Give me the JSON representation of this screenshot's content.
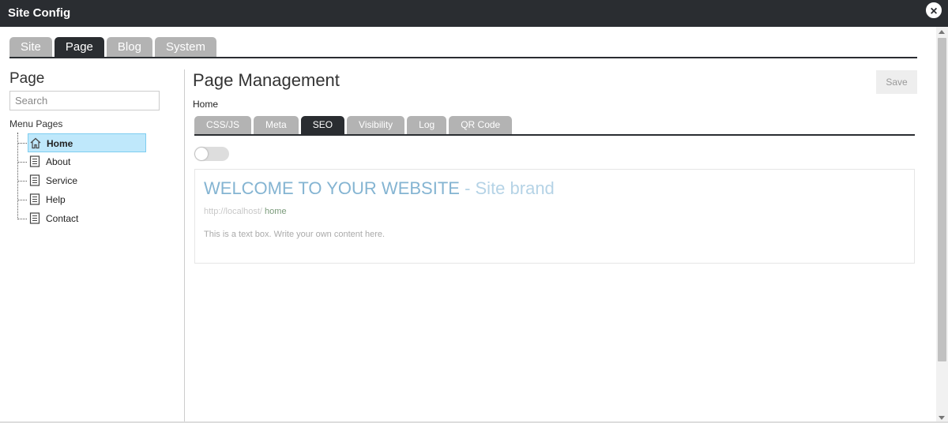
{
  "window": {
    "title": "Site Config",
    "close_icon": "close-icon"
  },
  "main_tabs": [
    {
      "label": "Site",
      "active": false
    },
    {
      "label": "Page",
      "active": true
    },
    {
      "label": "Blog",
      "active": false
    },
    {
      "label": "System",
      "active": false
    }
  ],
  "sidebar": {
    "heading": "Page",
    "search_placeholder": "Search",
    "menu_label": "Menu Pages",
    "items": [
      {
        "label": "Home",
        "icon": "home-icon",
        "selected": true
      },
      {
        "label": "About",
        "icon": "document-icon",
        "selected": false
      },
      {
        "label": "Service",
        "icon": "document-icon",
        "selected": false
      },
      {
        "label": "Help",
        "icon": "document-icon",
        "selected": false
      },
      {
        "label": "Contact",
        "icon": "document-icon",
        "selected": false
      }
    ]
  },
  "content": {
    "heading": "Page Management",
    "save_label": "Save",
    "breadcrumb": "Home",
    "sub_tabs": [
      {
        "label": "CSS/JS",
        "active": false
      },
      {
        "label": "Meta",
        "active": false
      },
      {
        "label": "SEO",
        "active": true
      },
      {
        "label": "Visibility",
        "active": false
      },
      {
        "label": "Log",
        "active": false
      },
      {
        "label": "QR Code",
        "active": false
      }
    ],
    "toggle_on": false,
    "preview": {
      "title_main": "WELCOME TO YOUR WEBSITE",
      "title_suffix": " - Site brand",
      "url_base": "http://localhost/",
      "url_slug": " home",
      "description": "This is a text box. Write your own content here."
    }
  },
  "colors": {
    "dark": "#2a2d31",
    "tab_inactive": "#b3b3b3",
    "selected_bg": "#bfe8fb",
    "title_blue": "#84b4d2"
  }
}
